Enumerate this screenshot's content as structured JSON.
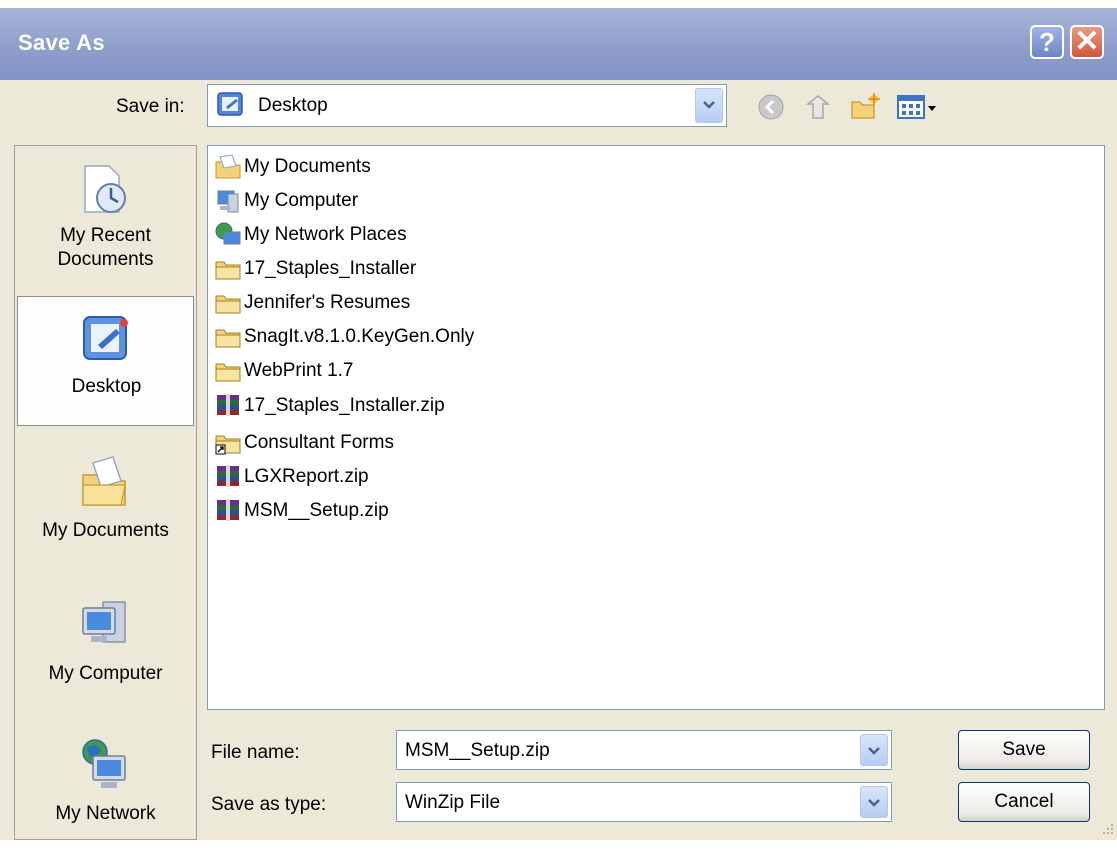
{
  "window": {
    "title": "Save As",
    "help_button": "?",
    "close_button": "✕"
  },
  "toolbar": {
    "save_in_label": "Save in:",
    "save_in_value": "Desktop",
    "tools": [
      "back-icon",
      "up-folder-icon",
      "new-folder-icon",
      "views-menu-icon"
    ]
  },
  "places": [
    {
      "label": "My Recent Documents",
      "icon": "recent-documents-icon",
      "selected": false
    },
    {
      "label": "Desktop",
      "icon": "desktop-icon",
      "selected": true
    },
    {
      "label": "My Documents",
      "icon": "my-documents-icon",
      "selected": false
    },
    {
      "label": "My Computer",
      "icon": "my-computer-icon",
      "selected": false
    },
    {
      "label": "My Network",
      "icon": "my-network-icon",
      "selected": false
    }
  ],
  "files": [
    {
      "name": "My Documents",
      "icon": "my-documents-folder-icon"
    },
    {
      "name": "My Computer",
      "icon": "computer-icon"
    },
    {
      "name": "My Network Places",
      "icon": "network-places-icon"
    },
    {
      "name": "17_Staples_Installer",
      "icon": "folder-icon"
    },
    {
      "name": "Jennifer's Resumes",
      "icon": "folder-icon"
    },
    {
      "name": "SnagIt.v8.1.0.KeyGen.Only",
      "icon": "folder-icon"
    },
    {
      "name": "WebPrint 1.7",
      "icon": "folder-icon"
    },
    {
      "name": "17_Staples_Installer.zip",
      "icon": "zip-archive-icon"
    },
    {
      "name": "Consultant Forms",
      "icon": "folder-shortcut-icon"
    },
    {
      "name": "LGXReport.zip",
      "icon": "zip-archive-icon"
    },
    {
      "name": "MSM__Setup.zip",
      "icon": "zip-archive-icon"
    }
  ],
  "form": {
    "file_name_label": "File name:",
    "file_name_value": "MSM__Setup.zip",
    "save_type_label": "Save as type:",
    "save_type_value": "WinZip File"
  },
  "buttons": {
    "save": "Save",
    "cancel": "Cancel"
  }
}
